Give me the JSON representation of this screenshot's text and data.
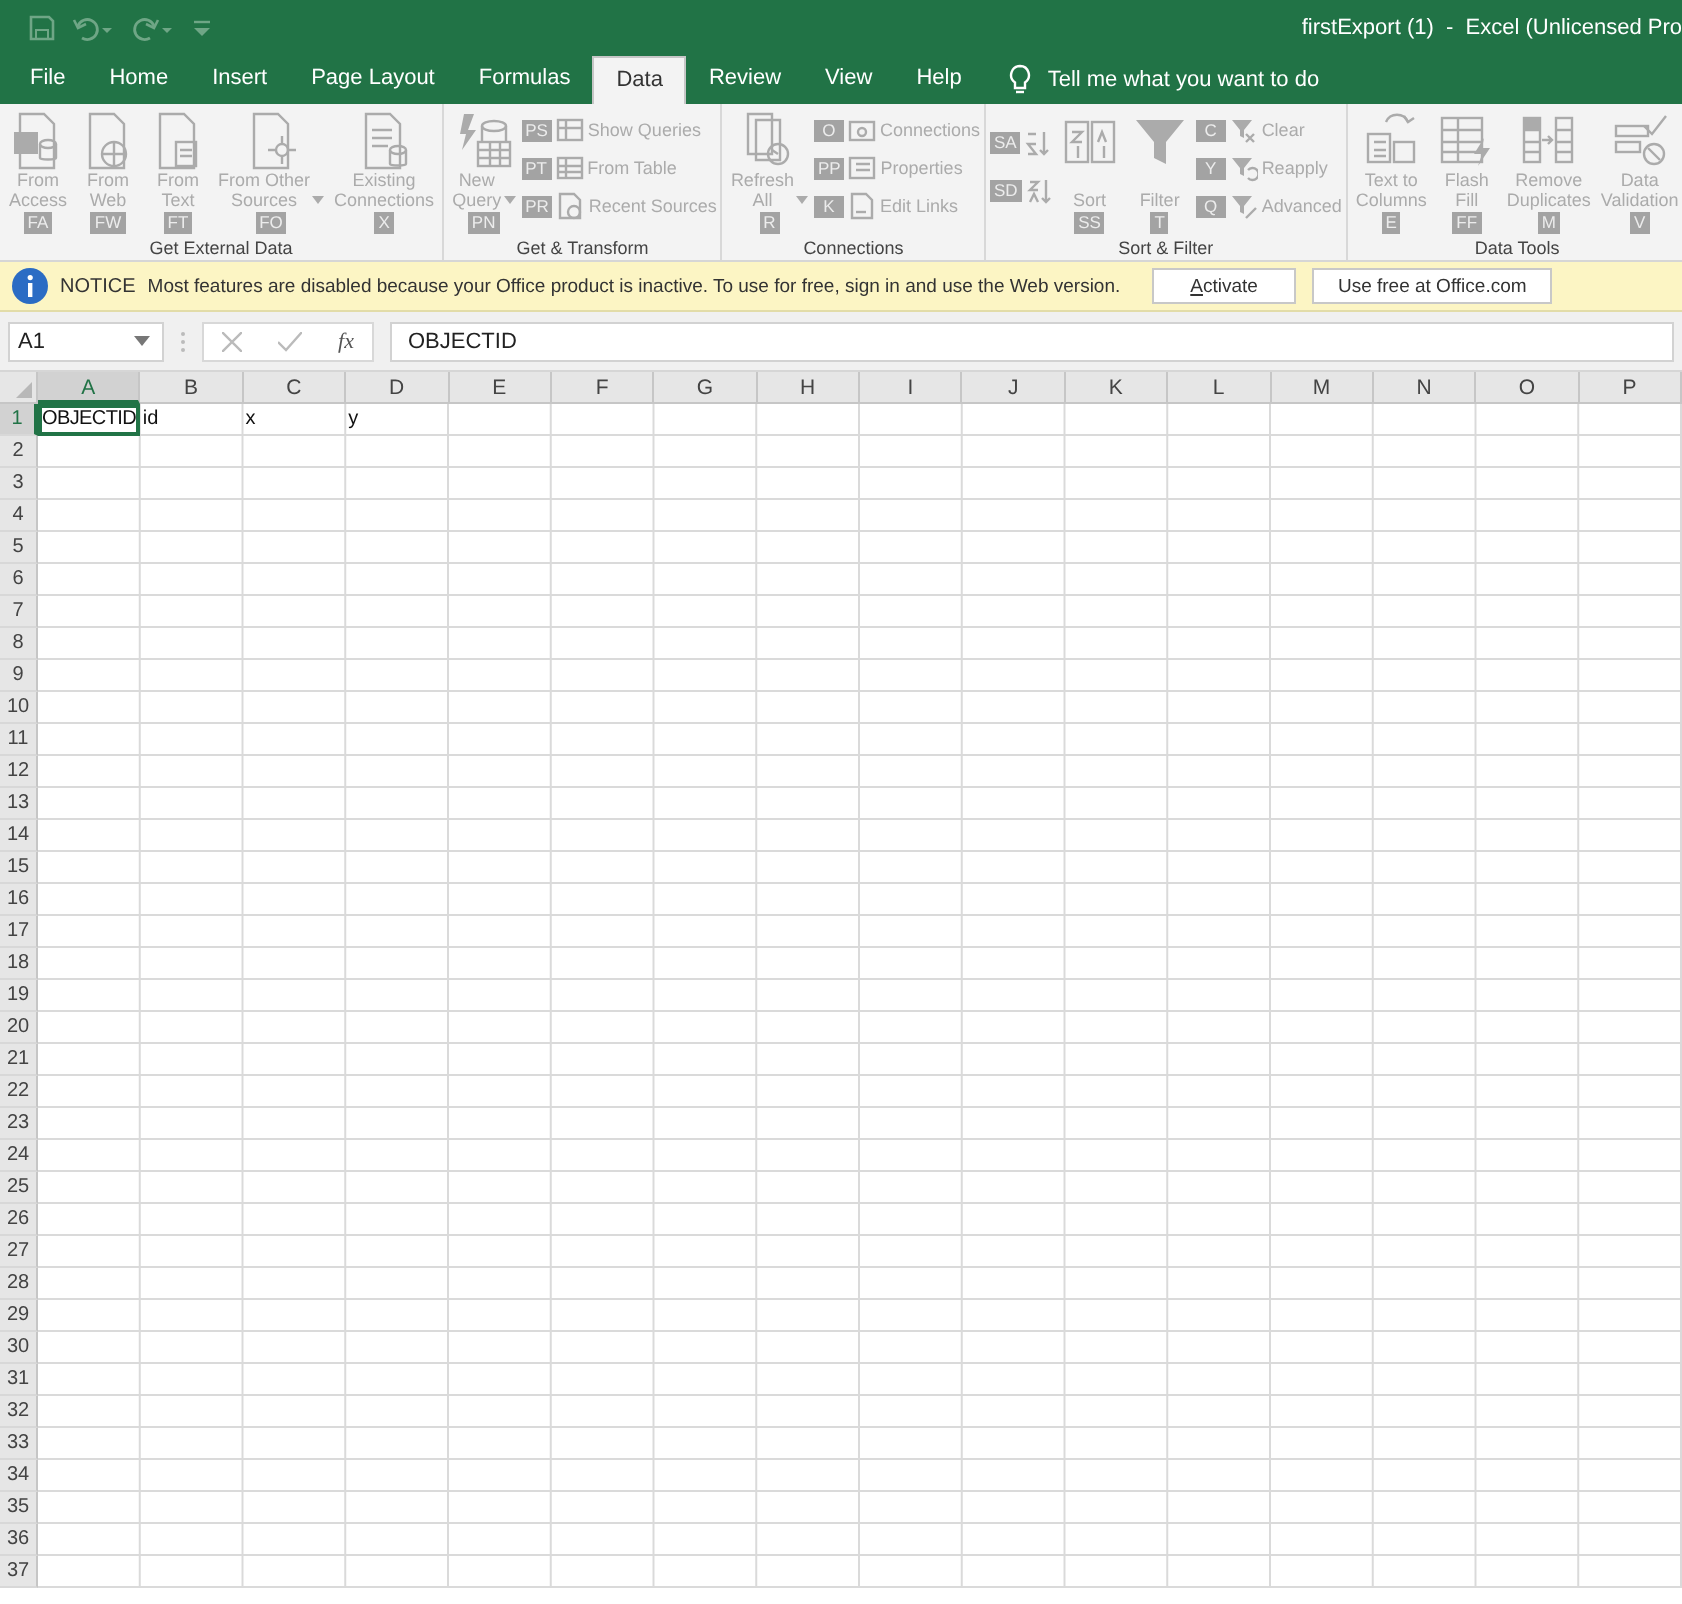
{
  "title_bar": {
    "title": "firstExport (1)  -  Excel (Unlicensed Pro"
  },
  "tabs": [
    {
      "label": "File",
      "selected": false
    },
    {
      "label": "Home",
      "selected": false
    },
    {
      "label": "Insert",
      "selected": false
    },
    {
      "label": "Page Layout",
      "selected": false
    },
    {
      "label": "Formulas",
      "selected": false
    },
    {
      "label": "Data",
      "selected": true
    },
    {
      "label": "Review",
      "selected": false
    },
    {
      "label": "View",
      "selected": false
    },
    {
      "label": "Help",
      "selected": false
    }
  ],
  "tell_me": "Tell me what you want to do",
  "ribbon_groups": [
    {
      "label": "Get External Data",
      "commands": [
        {
          "kind": "large",
          "label": "From Access",
          "keytip": "FA",
          "disabled": true
        },
        {
          "kind": "large",
          "label": "From Web",
          "keytip": "FW",
          "disabled": true
        },
        {
          "kind": "large",
          "label": "From Text",
          "keytip": "FT",
          "disabled": true
        },
        {
          "kind": "large",
          "label": "From Other Sources",
          "dropdown": true,
          "keytip": "FO",
          "disabled": true
        },
        {
          "kind": "large",
          "label": "Existing Connections",
          "keytip": "X",
          "disabled": true
        }
      ]
    },
    {
      "label": "Get & Transform",
      "commands": [
        {
          "kind": "large",
          "label": "New Query",
          "dropdown": true,
          "keytip": "PN",
          "disabled": true
        },
        {
          "kind": "small",
          "label": "Show Queries",
          "keytip": "PS",
          "disabled": true
        },
        {
          "kind": "small",
          "label": "From Table",
          "keytip": "PT",
          "disabled": true
        },
        {
          "kind": "small",
          "label": "Recent Sources",
          "keytip": "PR",
          "disabled": true
        }
      ]
    },
    {
      "label": "Connections",
      "commands": [
        {
          "kind": "large",
          "label": "Refresh All",
          "dropdown": true,
          "keytip": "R",
          "disabled": true
        },
        {
          "kind": "small",
          "label": "Connections",
          "keytip": "O",
          "disabled": true
        },
        {
          "kind": "small",
          "label": "Properties",
          "keytip": "PP",
          "disabled": true
        },
        {
          "kind": "small",
          "label": "Edit Links",
          "keytip": "K",
          "disabled": true
        }
      ]
    },
    {
      "label": "Sort & Filter",
      "commands": [
        {
          "kind": "icon",
          "keytip": "SA",
          "disabled": true
        },
        {
          "kind": "icon",
          "keytip": "SD",
          "disabled": true
        },
        {
          "kind": "large",
          "label": "Sort",
          "keytip": "SS",
          "disabled": true
        },
        {
          "kind": "large",
          "label": "Filter",
          "keytip": "T",
          "disabled": true
        },
        {
          "kind": "small",
          "label": "Clear",
          "keytip": "C",
          "disabled": true
        },
        {
          "kind": "small",
          "label": "Reapply",
          "keytip": "Y",
          "disabled": true
        },
        {
          "kind": "small",
          "label": "Advanced",
          "keytip": "Q",
          "disabled": true
        }
      ]
    },
    {
      "label": "Data Tools",
      "commands": [
        {
          "kind": "large",
          "label": "Text to Columns",
          "keytip": "E",
          "disabled": true
        },
        {
          "kind": "large",
          "label": "Flash Fill",
          "keytip": "FF",
          "disabled": true
        },
        {
          "kind": "large",
          "label": "Remove Duplicates",
          "keytip": "M",
          "disabled": true
        },
        {
          "kind": "large",
          "label": "Data Validation",
          "keytip": "V",
          "disabled": true
        }
      ]
    }
  ],
  "notice": {
    "label": "NOTICE",
    "message": "Most features are disabled because your Office product is inactive. To use for free, sign in and use the Web version.",
    "buttons": [
      "Activate",
      "Use free at Office.com"
    ]
  },
  "formula_bar": {
    "name_box": "A1",
    "function_label": "fx",
    "formula": "OBJECTID"
  },
  "grid": {
    "columns": [
      {
        "label": "A",
        "selected": true
      },
      {
        "label": "B",
        "selected": false
      },
      {
        "label": "C",
        "selected": false
      },
      {
        "label": "D",
        "selected": false
      },
      {
        "label": "E",
        "selected": false
      },
      {
        "label": "F",
        "selected": false
      },
      {
        "label": "G",
        "selected": false
      },
      {
        "label": "H",
        "selected": false
      },
      {
        "label": "I",
        "selected": false
      },
      {
        "label": "J",
        "selected": false
      },
      {
        "label": "K",
        "selected": false
      },
      {
        "label": "L",
        "selected": false
      },
      {
        "label": "M",
        "selected": false
      },
      {
        "label": "N",
        "selected": false
      },
      {
        "label": "O",
        "selected": false
      },
      {
        "label": "P",
        "selected": false
      }
    ],
    "rows": [
      {
        "label": "1",
        "selected": true,
        "cells": [
          {
            "text": "OBJECTID",
            "selected": true
          },
          {
            "text": "id",
            "selected": false
          },
          {
            "text": "x",
            "selected": false
          },
          {
            "text": "y",
            "selected": false
          }
        ]
      },
      {
        "label": "2",
        "selected": false
      },
      {
        "label": "3",
        "selected": false
      },
      {
        "label": "4",
        "selected": false
      },
      {
        "label": "5",
        "selected": false
      },
      {
        "label": "6",
        "selected": false
      },
      {
        "label": "7",
        "selected": false
      },
      {
        "label": "8",
        "selected": false
      },
      {
        "label": "9",
        "selected": false
      },
      {
        "label": "10",
        "selected": false
      },
      {
        "label": "11",
        "selected": false
      },
      {
        "label": "12",
        "selected": false
      },
      {
        "label": "13",
        "selected": false
      },
      {
        "label": "14",
        "selected": false
      },
      {
        "label": "15",
        "selected": false
      },
      {
        "label": "16",
        "selected": false
      },
      {
        "label": "17",
        "selected": false
      },
      {
        "label": "18",
        "selected": false
      },
      {
        "label": "19",
        "selected": false
      },
      {
        "label": "20",
        "selected": false
      },
      {
        "label": "21",
        "selected": false
      },
      {
        "label": "22",
        "selected": false
      },
      {
        "label": "23",
        "selected": false
      },
      {
        "label": "24",
        "selected": false
      },
      {
        "label": "25",
        "selected": false
      },
      {
        "label": "26",
        "selected": false
      },
      {
        "label": "27",
        "selected": false
      },
      {
        "label": "28",
        "selected": false
      },
      {
        "label": "29",
        "selected": false
      },
      {
        "label": "30",
        "selected": false
      },
      {
        "label": "31",
        "selected": false
      },
      {
        "label": "32",
        "selected": false
      },
      {
        "label": "33",
        "selected": false
      },
      {
        "label": "34",
        "selected": false
      },
      {
        "label": "35",
        "selected": false
      },
      {
        "label": "36",
        "selected": false
      },
      {
        "label": "37",
        "selected": false
      }
    ]
  }
}
